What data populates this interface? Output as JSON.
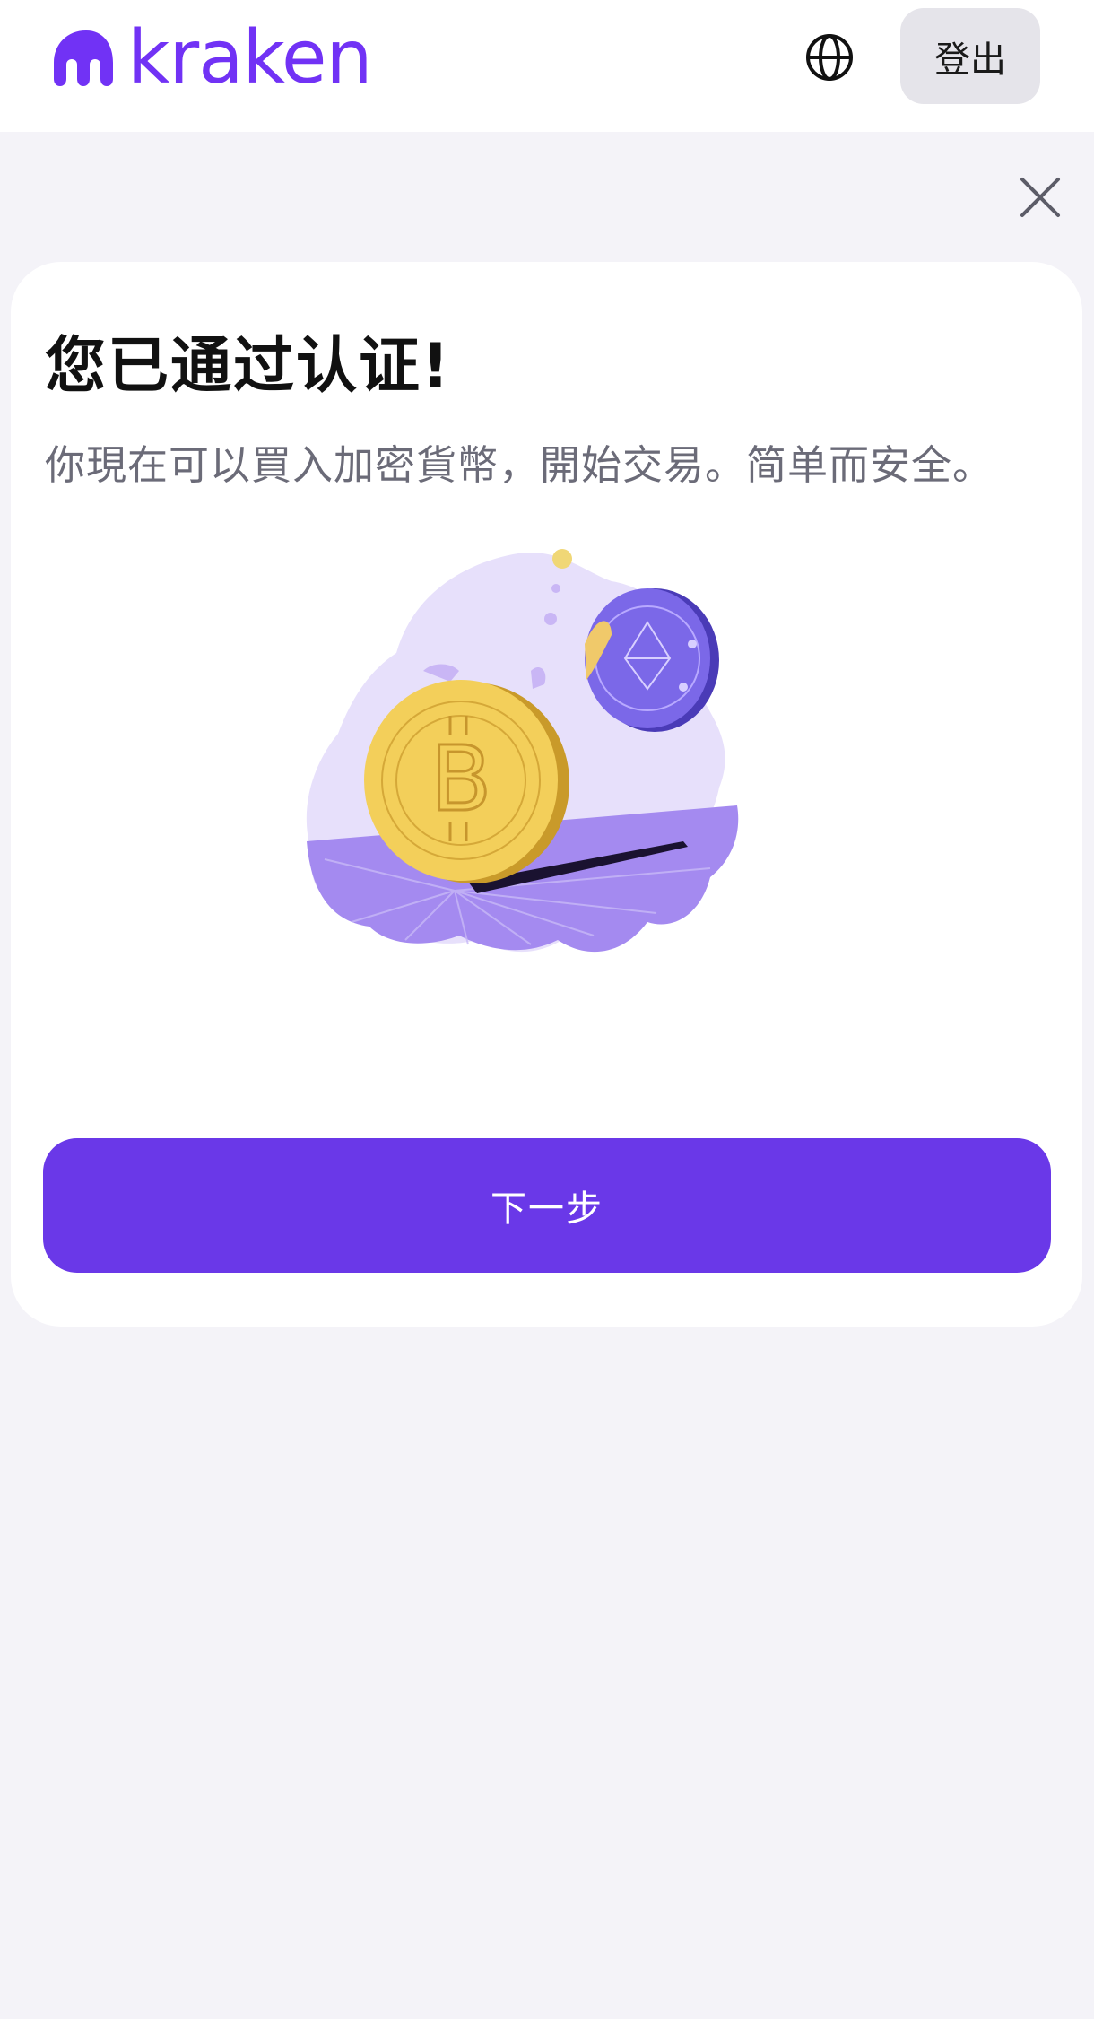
{
  "header": {
    "logo_text": "kraken",
    "logout_label": "登出"
  },
  "card": {
    "title": "您已通过认证!",
    "subtitle": "你現在可以買入加密貨幣，開始交易。简单而安全。",
    "next_label": "下一步"
  },
  "colors": {
    "brand": "#7132f5",
    "button": "#6a38e8",
    "background": "#f4f3f8",
    "coin_gold": "#f2c84b",
    "coin_purple": "#6b55e0"
  },
  "icons": {
    "language": "globe-icon",
    "close": "close-icon",
    "logo_mark": "kraken-logo-mark"
  }
}
